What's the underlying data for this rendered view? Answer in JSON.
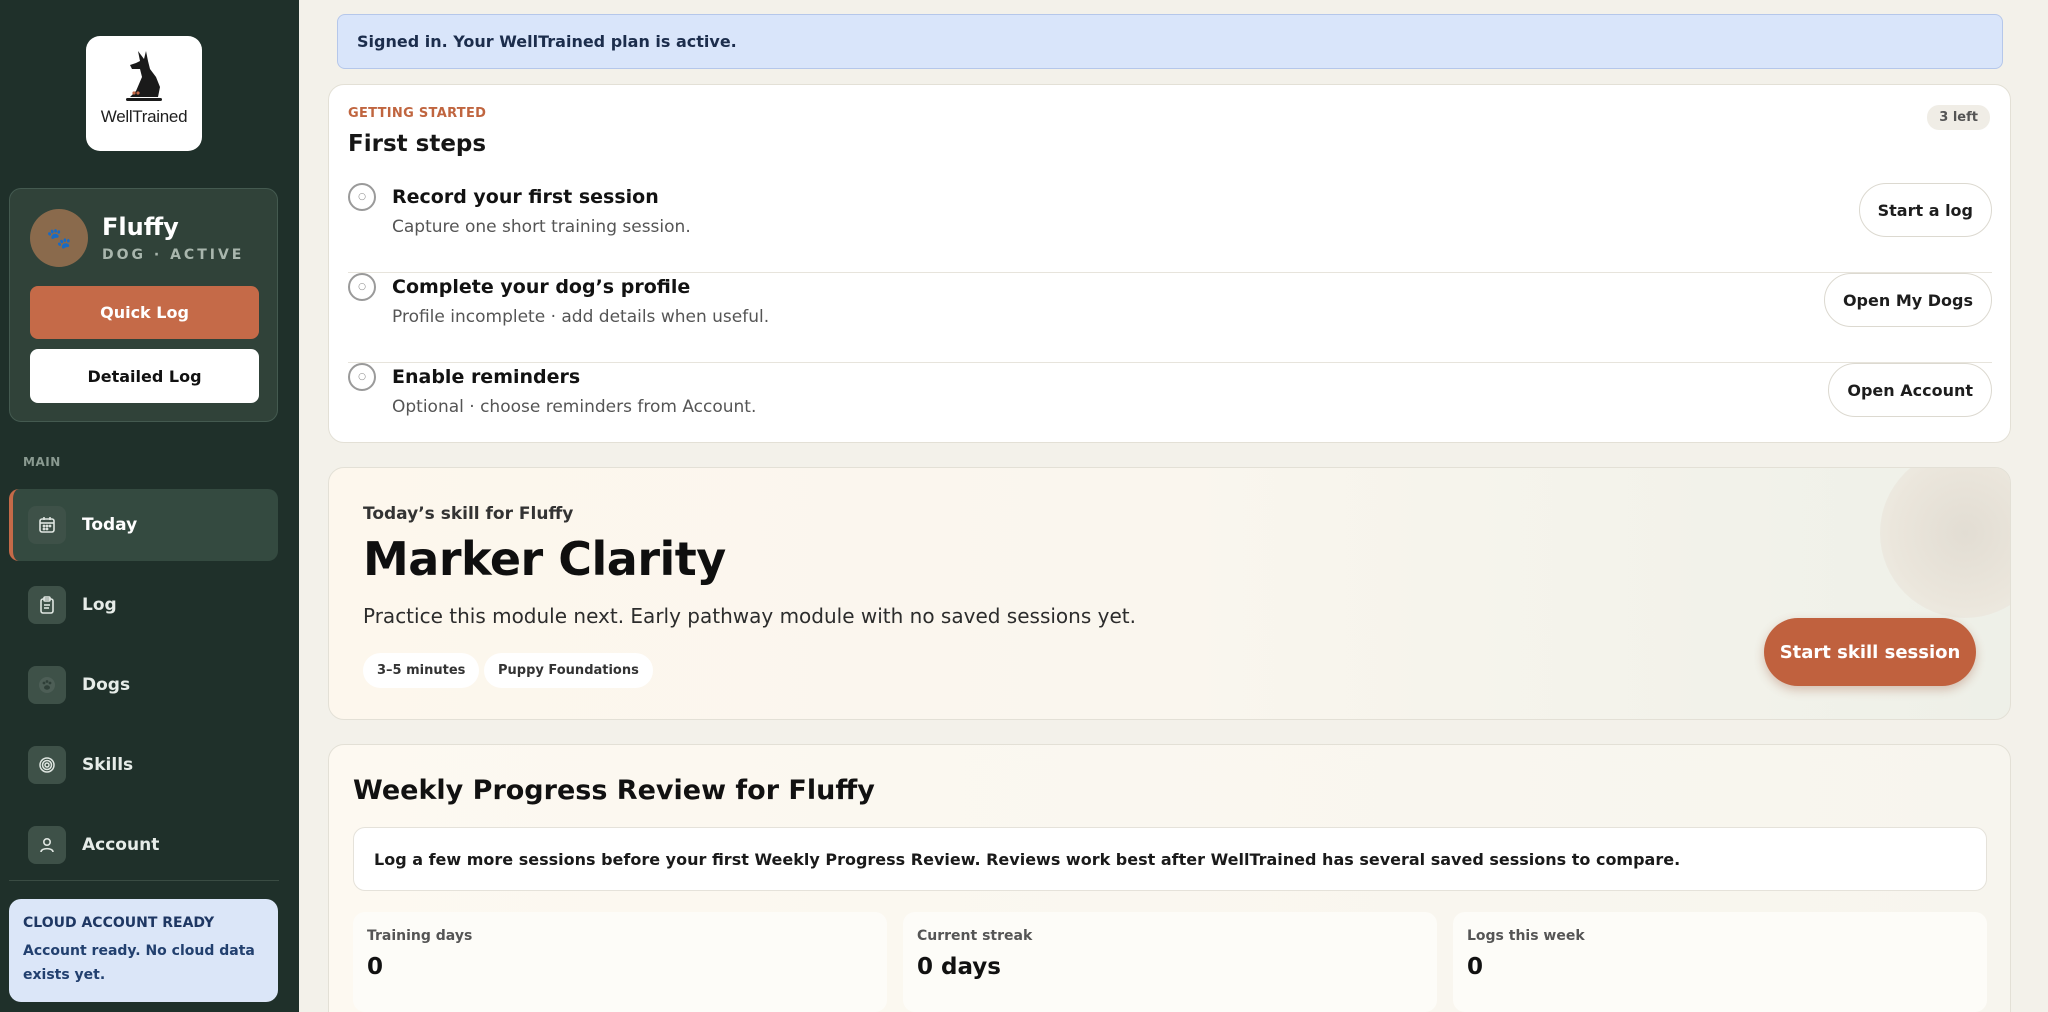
{
  "brand": {
    "name": "WellTrained"
  },
  "dog": {
    "name": "Fluffy",
    "status": "DOG · ACTIVE",
    "avatar_icon": "🐾"
  },
  "actions": {
    "quick_log": "Quick Log",
    "detailed_log": "Detailed Log"
  },
  "nav": {
    "section_label": "MAIN",
    "items": [
      {
        "label": "Today",
        "icon": "calendar-icon"
      },
      {
        "label": "Log",
        "icon": "clipboard-icon"
      },
      {
        "label": "Dogs",
        "icon": "paw-icon"
      },
      {
        "label": "Skills",
        "icon": "target-icon"
      },
      {
        "label": "Account",
        "icon": "user-icon"
      }
    ]
  },
  "cloud": {
    "title": "CLOUD ACCOUNT READY",
    "text": "Account ready. No cloud data exists yet."
  },
  "banner": {
    "text": "Signed in. Your WellTrained plan is active."
  },
  "first_steps": {
    "eyebrow": "GETTING STARTED",
    "title": "First steps",
    "badge": "3 left",
    "steps": [
      {
        "title": "Record your first session",
        "subtitle": "Capture one short training session.",
        "button": "Start a log"
      },
      {
        "title": "Complete your dog’s profile",
        "subtitle": "Profile incomplete · add details when useful.",
        "button": "Open My Dogs"
      },
      {
        "title": "Enable reminders",
        "subtitle": "Optional · choose reminders from Account.",
        "button": "Open Account"
      }
    ]
  },
  "skill": {
    "for_label": "Today’s skill for Fluffy",
    "title": "Marker Clarity",
    "description": "Practice this module next. Early pathway module with no saved sessions yet.",
    "chips": [
      "3–5 minutes",
      "Puppy Foundations"
    ],
    "button": "Start skill session"
  },
  "weekly": {
    "title": "Weekly Progress Review for Fluffy",
    "note": "Log a few more sessions before your first Weekly Progress Review. Reviews work best after WellTrained has several saved sessions to compare.",
    "stats": [
      {
        "label": "Training days",
        "value": "0"
      },
      {
        "label": "Current streak",
        "value": "0 days"
      },
      {
        "label": "Logs this week",
        "value": "0"
      }
    ]
  }
}
